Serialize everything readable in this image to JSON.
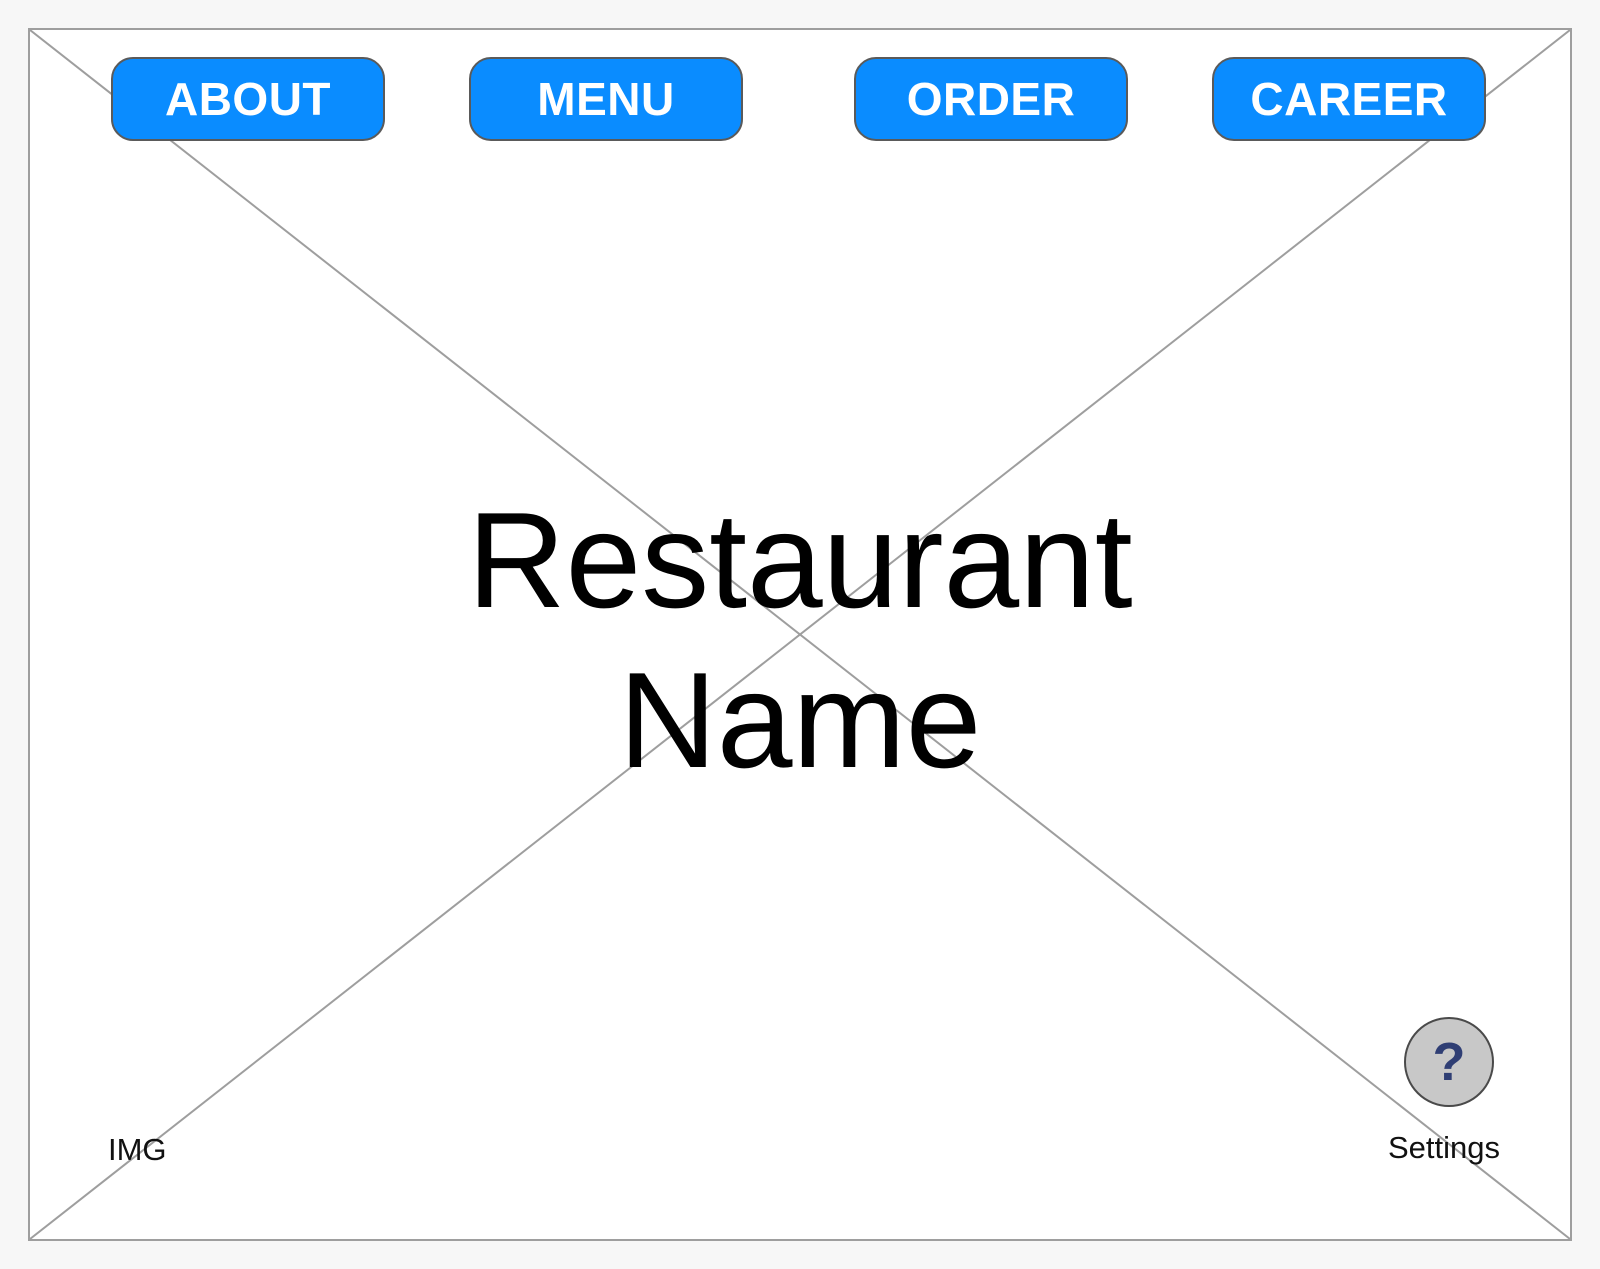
{
  "colors": {
    "button_bg": "#0a8cff",
    "button_text": "#ffffff",
    "placeholder_line": "#9e9e9e",
    "help_bg": "#c8c8c8",
    "help_glyph": "#2f3e74"
  },
  "nav": {
    "about_label": "ABOUT",
    "menu_label": "MENU",
    "order_label": "ORDER",
    "career_label": "CAREER"
  },
  "hero": {
    "title_line1": "Restaurant",
    "title_line2": "Name",
    "image_label": "IMG"
  },
  "help": {
    "icon": "question-mark-icon",
    "glyph": "?",
    "label": "Settings"
  }
}
